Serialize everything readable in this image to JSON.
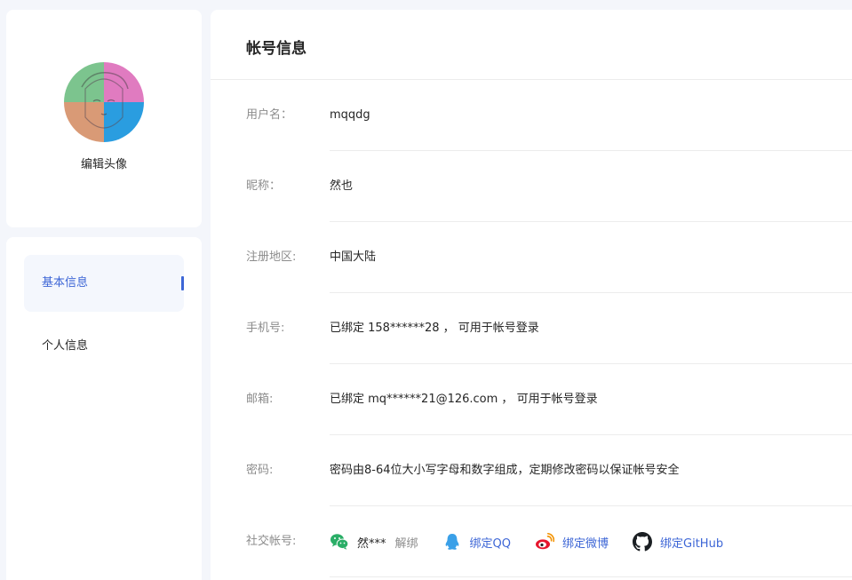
{
  "avatar": {
    "edit_label": "编辑头像"
  },
  "menu": {
    "items": [
      {
        "label": "基本信息",
        "active": true
      },
      {
        "label": "个人信息",
        "active": false
      }
    ]
  },
  "account": {
    "title": "帐号信息",
    "rows": [
      {
        "label": "用户名：",
        "value": "mqqdg"
      },
      {
        "label": "昵称：",
        "value": "然也"
      },
      {
        "label": "注册地区:",
        "value": "中国大陆"
      },
      {
        "label": "手机号:",
        "value": "已绑定 158******28 ，  可用于帐号登录"
      },
      {
        "label": "邮箱:",
        "value": "已绑定 mq******21@126.com ，  可用于帐号登录"
      },
      {
        "label": "密码:",
        "value": "密码由8-64位大小写字母和数字组成，定期修改密码以保证帐号安全"
      }
    ],
    "social": {
      "label": "社交帐号:",
      "wechat": {
        "icon": "wechat-icon",
        "name": "然***",
        "action": "解绑"
      },
      "qq": {
        "icon": "qq-icon",
        "action": "绑定QQ"
      },
      "weibo": {
        "icon": "weibo-icon",
        "action": "绑定微博"
      },
      "github": {
        "icon": "github-icon",
        "action": "绑定GitHub"
      }
    }
  },
  "colors": {
    "accent": "#3d66d6",
    "label": "#8c8c8c",
    "wechat": "#2aae67",
    "qq": "#3aa0e8",
    "weibo": "#e6162d"
  }
}
